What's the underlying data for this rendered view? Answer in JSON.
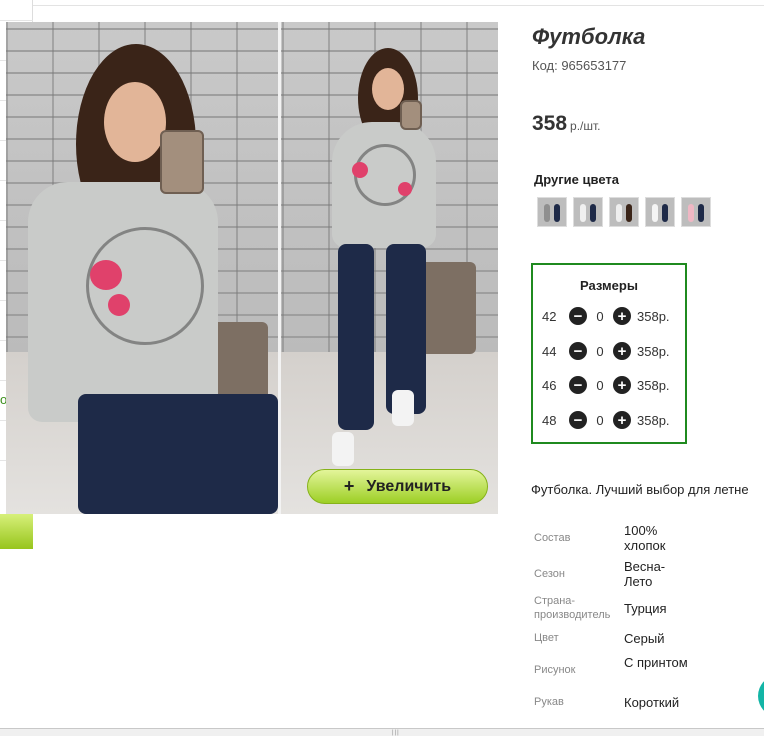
{
  "product": {
    "title": "Футболка",
    "code_label": "Код: 965653177",
    "price_value": "358",
    "price_unit": "р./шт.",
    "zoom_button_label": "Увеличить",
    "zoom_button_icon": "+"
  },
  "colors": {
    "title": "Другие цвета",
    "swatches": [
      {
        "icon": "thumb-gray-tshirt",
        "accent": "#c9c9c9"
      },
      {
        "icon": "thumb-white-tshirt",
        "accent": "#f0f0f0"
      },
      {
        "icon": "thumb-white-tshirt",
        "accent": "#eeeeee"
      },
      {
        "icon": "thumb-white-tshirt",
        "accent": "#f4f4f4"
      },
      {
        "icon": "thumb-pink-tshirt",
        "accent": "#efb7c4"
      }
    ]
  },
  "sizes": {
    "title": "Размеры",
    "minus_icon": "−",
    "plus_icon": "+",
    "rows": [
      {
        "size": "42",
        "qty": "0",
        "price": "358р."
      },
      {
        "size": "44",
        "qty": "0",
        "price": "358р."
      },
      {
        "size": "46",
        "qty": "0",
        "price": "358р."
      },
      {
        "size": "48",
        "qty": "0",
        "price": "358р."
      }
    ]
  },
  "description": "Футболка. Лучший выбор для летне",
  "attributes": [
    {
      "label": "Состав",
      "value": "100% хлопок"
    },
    {
      "label": "Сезон",
      "value": "Весна-Лето"
    },
    {
      "label": "Страна-производитель",
      "value": "Турция"
    },
    {
      "label": "Цвет",
      "value": "Серый"
    },
    {
      "label": "Рисунок",
      "value": "С принтом"
    },
    {
      "label": "Рукав",
      "value": "Короткий"
    }
  ],
  "left_strip_letter": "o",
  "bottom_grip": "|||",
  "colors_palette": {
    "accent_green": "#9dcf25",
    "border_green": "#1f8a1f",
    "chat_teal": "#13b5a6"
  }
}
